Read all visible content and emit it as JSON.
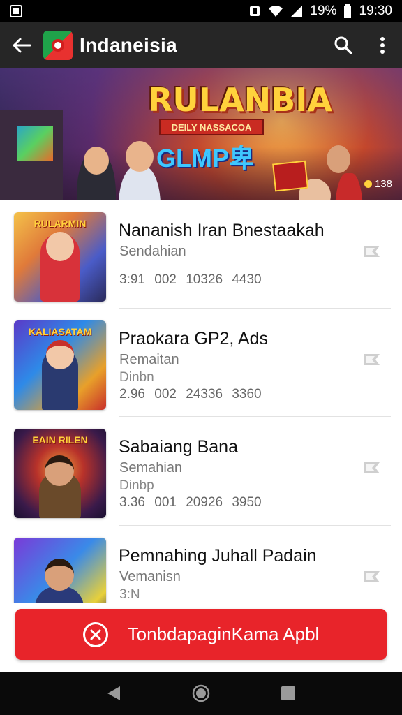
{
  "status_bar": {
    "battery_percent": "19%",
    "time": "19:30"
  },
  "toolbar": {
    "title": "Indaneisia"
  },
  "banner": {
    "title": "RULANBIA",
    "ribbon": "DEILY NASSACOA",
    "logo_text": "GLMP卑",
    "count": "138"
  },
  "list": {
    "items": [
      {
        "thumb_label": "RULARMIN",
        "title": "Nananish Iran Bnestaakah",
        "subtitle": "Sendahian",
        "meta": "",
        "stats": "3:91  002  10326  4430"
      },
      {
        "thumb_label": "KALIASATAM",
        "title": "Praokara GP2, Ads",
        "subtitle": "Remaitan",
        "meta": "Dinbn",
        "stats": "2.96  002  24336  3360"
      },
      {
        "thumb_label": "EAIN RILEN",
        "title": "Sabaiang Bana",
        "subtitle": "Semahian",
        "meta": "Dinbp",
        "stats": "3.36  001  20926  3950"
      },
      {
        "thumb_label": "",
        "title": "Pemnahing Juhall Padain",
        "subtitle": "Vemanisn",
        "meta": "3:N",
        "stats": ""
      }
    ]
  },
  "cta": {
    "label": "TonbdapaginKama Apbl"
  },
  "colors": {
    "accent": "#e8242a",
    "toolbar": "#262626"
  }
}
